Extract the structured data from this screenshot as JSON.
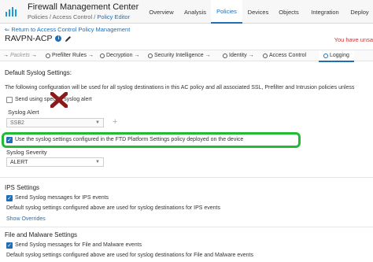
{
  "header": {
    "title": "Firewall Management Center",
    "breadcrumb_prefix": "Policies / Access Control / ",
    "breadcrumb_current": "Policy Editor",
    "nav": [
      "Overview",
      "Analysis",
      "Policies",
      "Devices",
      "Objects",
      "Integration",
      "Deploy"
    ],
    "active_nav": "Policies"
  },
  "back_link": "Return to Access Control Policy Management",
  "policy": {
    "name": "RAVPN-ACP",
    "unsaved_text": "You have unsa"
  },
  "steps": {
    "packets": "Packets",
    "prefilter": "Prefilter Rules",
    "decryption": "Decryption",
    "security_intel": "Security Intelligence",
    "identity": "Identity",
    "access_control": "Access Control",
    "logging": "Logging"
  },
  "default_syslog": {
    "title": "Default Syslog Settings:",
    "description": "The following configuration will be used for all syslog destinations in this AC policy and all associated SSL, Prefilter and Intrusion policies unless",
    "send_alert_label": "Send using specific syslog alert",
    "syslog_alert_label": "Syslog Alert",
    "syslog_alert_value": "SSB2",
    "use_ftd_label": "Use the syslog settings configured in the FTD Platform Settings policy deployed on the device",
    "severity_label": "Syslog Severity",
    "severity_value": "ALERT"
  },
  "ips": {
    "title": "IPS Settings",
    "send_label": "Send Syslog messages for IPS events",
    "note": "Default syslog settings configured above are used for syslog destinations for IPS events",
    "show_overrides": "Show Overrides"
  },
  "file_malware": {
    "title": "File and Malware Settings",
    "send_label": "Send Syslog messages for File and Malware events",
    "note": "Default syslog settings configured above are used for syslog destinations for File and Malware events"
  },
  "colors": {
    "accent": "#1e6fb8",
    "highlight": "#22bb33",
    "cross_mark": "#8b1a1a"
  }
}
